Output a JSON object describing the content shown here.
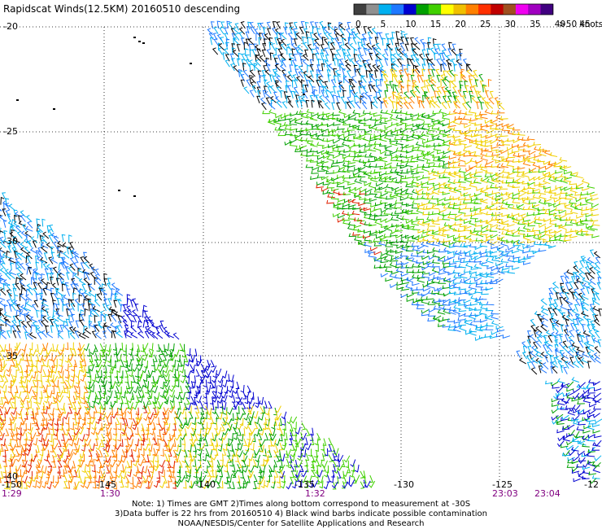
{
  "title": "Rapidscat Winds(12.5KM) 20160510 descending",
  "legend": {
    "unit": ">50 knots",
    "ticks": [
      "0",
      "5",
      "10",
      "15",
      "20",
      "25",
      "30",
      "35",
      "40",
      "45"
    ],
    "colors": [
      "#404040",
      "#909090",
      "#00b0f0",
      "#1e78ff",
      "#0000d0",
      "#00a000",
      "#40d000",
      "#ffff00",
      "#f0c000",
      "#ff8000",
      "#ff3000",
      "#c00000",
      "#a05020",
      "#f000f0",
      "#a000c0",
      "#400080"
    ]
  },
  "lat_labels": [
    "-20",
    "-25",
    "-30",
    "-35",
    "-40"
  ],
  "lon_labels": [
    "-150",
    "-145",
    "-140",
    "-135",
    "-130",
    "-125",
    "-12"
  ],
  "time_labels": [
    "1:29",
    "1:30",
    "1:32",
    "23:03",
    "23:04"
  ],
  "notes": [
    "Note: 1) Times are GMT 2)Times along bottom correspond to measurement at -30S",
    "3)Data buffer is 22 hrs from 20160510 4) Black wind barbs indicate possible contamination",
    "NOAA/NESDIS/Center for Satellite Applications and Research"
  ]
}
